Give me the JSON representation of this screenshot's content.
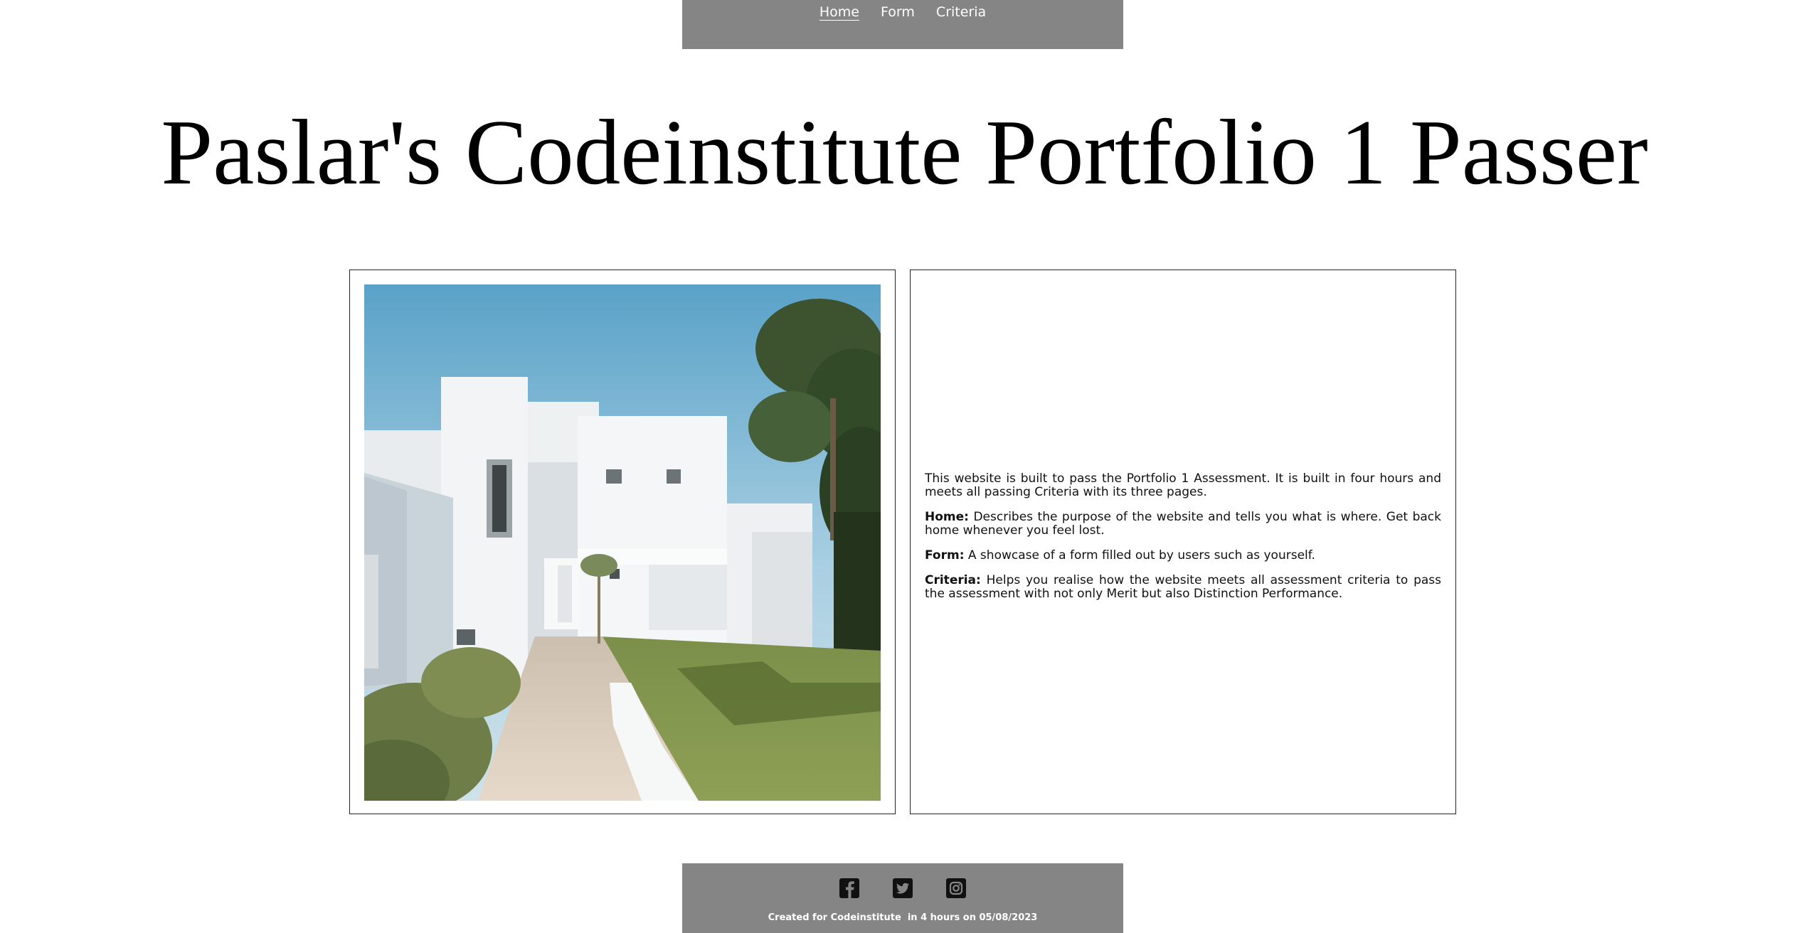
{
  "nav": {
    "items": [
      {
        "label": "Home",
        "active": true
      },
      {
        "label": "Form",
        "active": false
      },
      {
        "label": "Criteria",
        "active": false
      }
    ]
  },
  "page_title": "Paslar's Codeinstitute Portfolio 1 Passer",
  "intro": {
    "summary": "This website is built to pass the Portfolio 1 Assessment. It is built in four hours and meets all passing Criteria with its three pages.",
    "sections": [
      {
        "term": "Home:",
        "text": " Describes the purpose of the website and tells you what is where. Get back home whenever you feel lost."
      },
      {
        "term": "Form:",
        "text": " A showcase of a form filled out by users such as yourself."
      },
      {
        "term": "Criteria:",
        "text": " Helps you realise how the website meets all assessment criteria to pass the assessment with not only Merit but also Distinction Performance."
      }
    ]
  },
  "footer": {
    "social_icons": [
      "facebook-icon",
      "twitter-icon",
      "instagram-icon"
    ],
    "note": "Created for Codeinstitute  in 4 hours on 05/08/2023"
  },
  "colors": {
    "bar_gray": "#858585",
    "text": "#111111",
    "link": "#ffffff"
  }
}
